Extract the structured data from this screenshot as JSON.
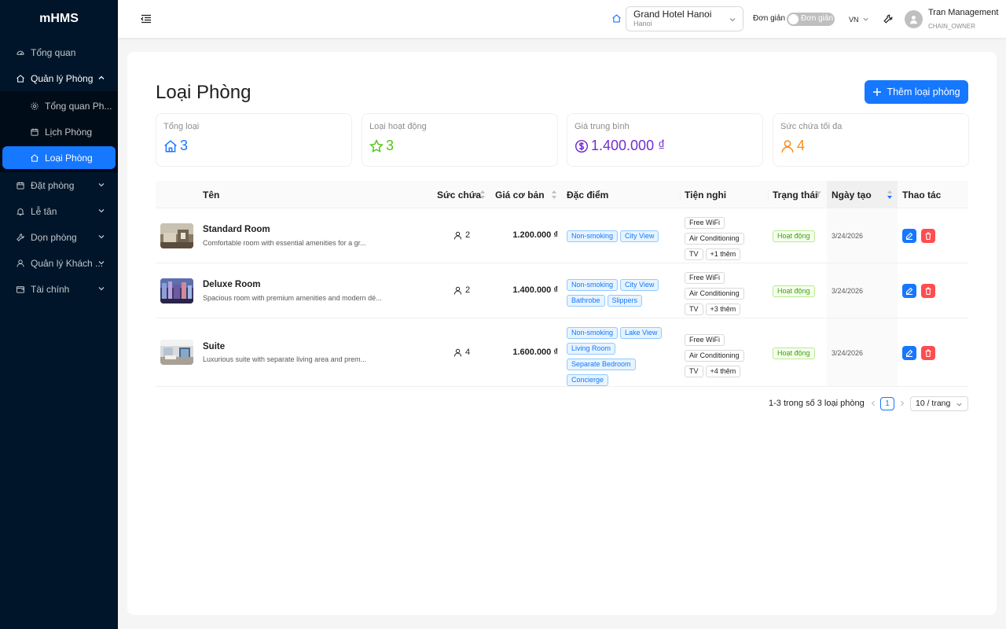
{
  "app": {
    "logo": "mHMS"
  },
  "sidebar": {
    "items": [
      {
        "label": "Tổng quan",
        "icon": "dashboard-icon"
      },
      {
        "label": "Quản lý Phòng",
        "icon": "home-icon"
      },
      {
        "label": "Đặt phòng",
        "icon": "calendar-icon"
      },
      {
        "label": "Lễ tân",
        "icon": "bell-icon"
      },
      {
        "label": "Dọn phòng",
        "icon": "tool-icon"
      },
      {
        "label": "Quản lý Khách ...",
        "icon": "user-icon"
      },
      {
        "label": "Tài chính",
        "icon": "wallet-icon"
      }
    ],
    "sub_items": [
      {
        "label": "Tổng quan Ph...",
        "icon": "setting-icon"
      },
      {
        "label": "Lịch Phòng",
        "icon": "schedule-icon"
      },
      {
        "label": "Loại Phòng",
        "icon": "home-icon"
      }
    ]
  },
  "header": {
    "hotel_name": "Grand Hotel Hanoi",
    "hotel_city": "Hanoi",
    "mode_label": "Đơn giản",
    "mode_toggle_text": "Đơn giản",
    "language": "VN",
    "user_name": "Tran Management",
    "user_role": "CHAIN_OWNER"
  },
  "page": {
    "title": "Loại Phòng",
    "add_button": "Thêm loại phòng"
  },
  "stats": [
    {
      "label": "Tổng loại",
      "value": "3",
      "color": "#1677ff",
      "icon": "home-icon"
    },
    {
      "label": "Loại hoạt động",
      "value": "3",
      "color": "#52c41a",
      "icon": "star-icon"
    },
    {
      "label": "Giá trung bình",
      "value": "1.400.000 ₫",
      "color": "#722ed1",
      "icon": "dollar-icon"
    },
    {
      "label": "Sức chứa tối đa",
      "value": "4",
      "color": "#fa8c16",
      "icon": "user-icon"
    }
  ],
  "table": {
    "columns": [
      "Tên",
      "Sức chứa",
      "Giá cơ bản",
      "Đặc điểm",
      "Tiện nghi",
      "Trạng thái",
      "Ngày tạo",
      "Thao tác"
    ],
    "rows": [
      {
        "name": "Standard Room",
        "desc": "Comfortable room with essential amenities for a gr...",
        "capacity": "2",
        "price": "1.200.000 ₫",
        "features": [
          "Non-smoking",
          "City View"
        ],
        "amenities": [
          "Free WiFi",
          "Air Conditioning",
          "TV",
          "+1 thêm"
        ],
        "status": "Hoạt động",
        "created": "3/24/2026"
      },
      {
        "name": "Deluxe Room",
        "desc": "Spacious room with premium amenities and modern dé...",
        "capacity": "2",
        "price": "1.400.000 ₫",
        "features": [
          "Non-smoking",
          "City View",
          "Bathrobe",
          "Slippers"
        ],
        "amenities": [
          "Free WiFi",
          "Air Conditioning",
          "TV",
          "+3 thêm"
        ],
        "status": "Hoạt động",
        "created": "3/24/2026"
      },
      {
        "name": "Suite",
        "desc": "Luxurious suite with separate living area and prem...",
        "capacity": "4",
        "price": "1.600.000 ₫",
        "features": [
          "Non-smoking",
          "Lake View",
          "Living Room",
          "Separate Bedroom",
          "Concierge"
        ],
        "amenities": [
          "Free WiFi",
          "Air Conditioning",
          "TV",
          "+4 thêm"
        ],
        "status": "Hoạt động",
        "created": "3/24/2026"
      }
    ]
  },
  "pagination": {
    "summary": "1-3 trong số 3 loại phòng",
    "current_page": "1",
    "page_size": "10 / trang"
  }
}
